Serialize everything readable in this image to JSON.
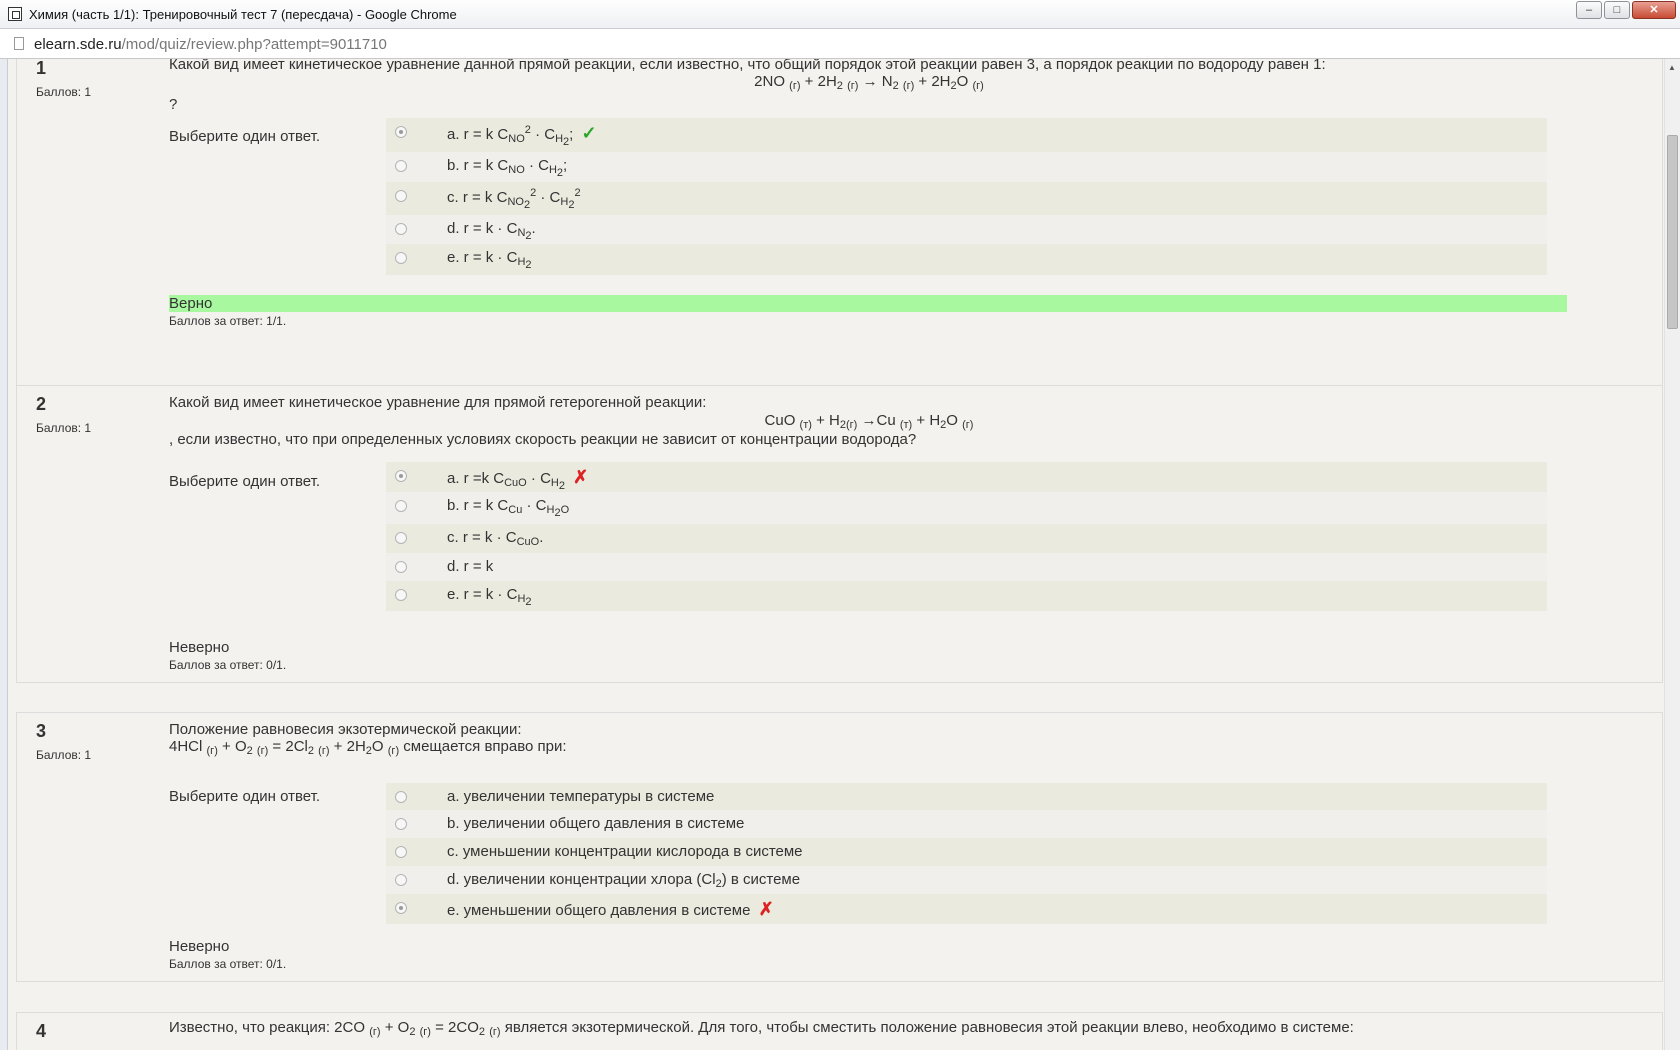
{
  "window": {
    "title": "Химия (часть 1/1): Тренировочный тест 7 (пересдача) - Google Chrome",
    "minimize": "‒",
    "maximize": "□",
    "close": "✕"
  },
  "address": {
    "host": "elearn.sde.ru",
    "path": "/mod/quiz/review.php?attempt=9011710"
  },
  "prompt": "Выберите один ответ.",
  "questions": [
    {
      "number": "1",
      "grade": "Баллов: 1",
      "text_line1": "Какой вид имеет кинетическое уравнение данной прямой реакции, если известно, что общий порядок этой реакции равен 3, а порядок реакции по водороду равен 1:",
      "text_line3": "?",
      "feedback": "Верно",
      "score": "Баллов за ответ: 1/1."
    },
    {
      "number": "2",
      "grade": "Баллов: 1",
      "text_line1": "Какой вид имеет кинетическое уравнение для прямой гетерогенной реакции:",
      "text_line3": ", если известно, что при определенных условиях скорость реакции не зависит от концентрации водорода?",
      "feedback": "Неверно",
      "score": "Баллов за ответ: 0/1."
    },
    {
      "number": "3",
      "grade": "Баллов: 1",
      "text_line1": "Положение равновесия экзотермической реакции:",
      "text_line2_suffix": "смещается вправо при:",
      "answers": [
        "a. увеличении температуры в системе",
        "b. увеличении общего давления в системе",
        "c. уменьшении концентрации кислорода в системе",
        "d. увеличении концентрации хлора (Cl",
        "e. уменьшении общего давления в системе"
      ],
      "answer_d_suffix": ") в системе",
      "feedback": "Неверно",
      "score": "Баллов за ответ: 0/1."
    },
    {
      "number": "4",
      "text_prefix": "Известно, что реакция: 2CO",
      "text_suffix": "является экзотермической. Для того, чтобы сместить положение равновесия этой реакции влево, необходимо в системе:"
    }
  ],
  "marks": {
    "correct": "✓",
    "incorrect": "✗"
  }
}
